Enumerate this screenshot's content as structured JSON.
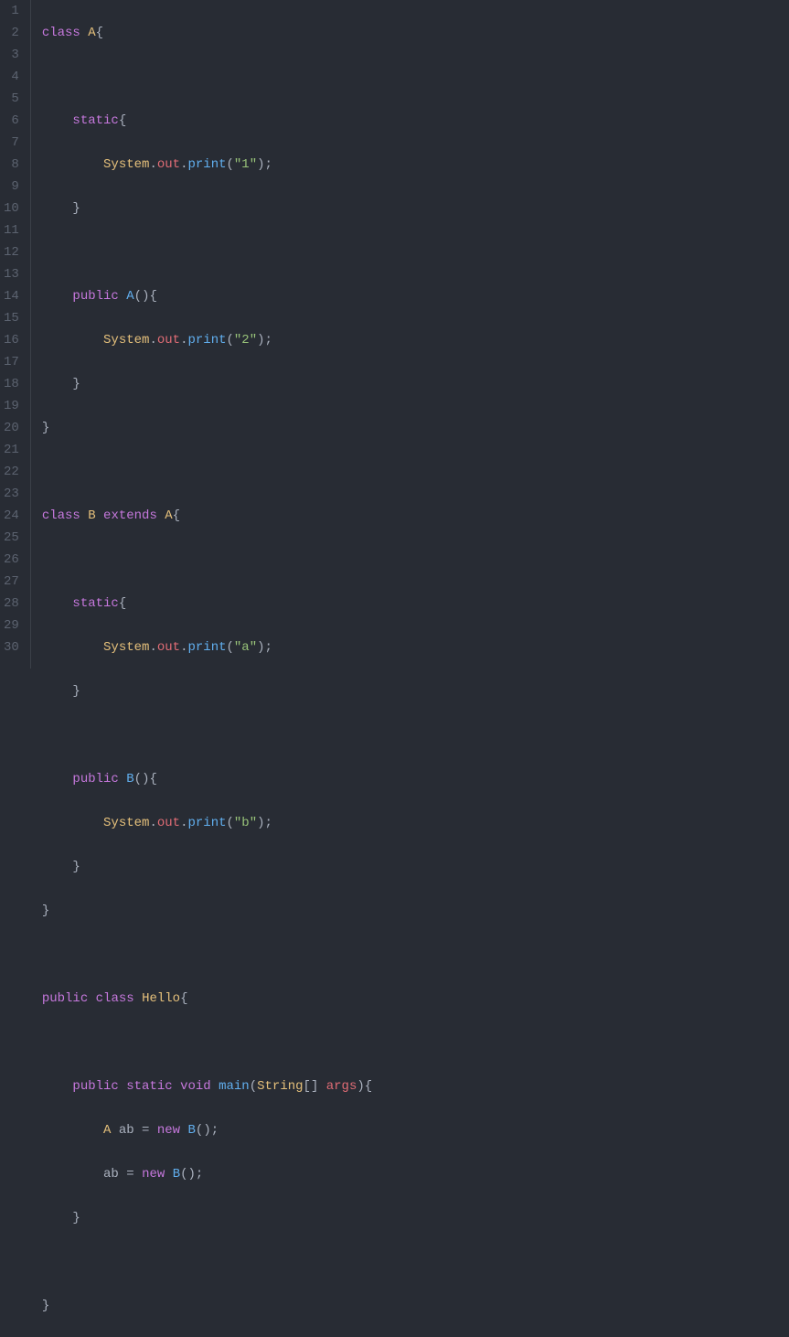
{
  "lines": {
    "n1": "1",
    "n2": "2",
    "n3": "3",
    "n4": "4",
    "n5": "5",
    "n6": "6",
    "n7": "7",
    "n8": "8",
    "n9": "9",
    "n10": "10",
    "n11": "11",
    "n12": "12",
    "n13": "13",
    "n14": "14",
    "n15": "15",
    "n16": "16",
    "n17": "17",
    "n18": "18",
    "n19": "19",
    "n20": "20",
    "n21": "21",
    "n22": "22",
    "n23": "23",
    "n24": "24",
    "n25": "25",
    "n26": "26",
    "n27": "27",
    "n28": "28",
    "n29": "29",
    "n30": "30"
  },
  "tok": {
    "class": "class",
    "A": "A",
    "B": "B",
    "Hello": "Hello",
    "static": "static",
    "public": "public",
    "extends": "extends",
    "void": "void",
    "new": "new",
    "main": "main",
    "System": "System",
    "out": "out",
    "print": "print",
    "String": "String",
    "args": "args",
    "ab": "ab",
    "str1": "\"1\"",
    "str2": "\"2\"",
    "stra": "\"a\"",
    "strb": "\"b\"",
    "lbrace": "{",
    "rbrace": "}",
    "lparen": "(",
    "rparen": ")",
    "lbracket": "[",
    "rbracket": "]",
    "semi": ";",
    "dot": ".",
    "eq": " = ",
    "sp": " "
  }
}
